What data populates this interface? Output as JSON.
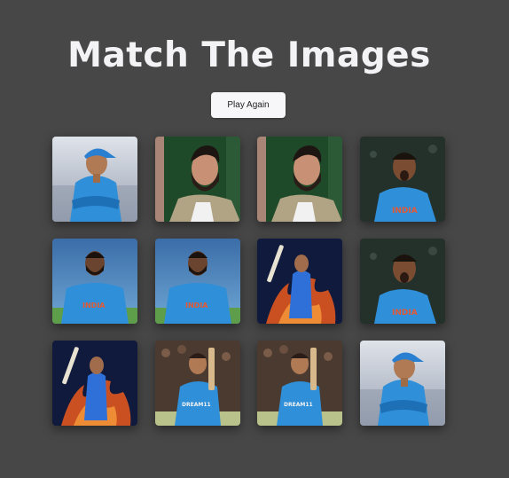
{
  "game": {
    "title": "Match The Images",
    "play_again_label": "Play Again"
  },
  "cards": [
    {
      "image": "player-cap-arms-crossed"
    },
    {
      "image": "player-beard-green-backdrop"
    },
    {
      "image": "player-beard-green-backdrop"
    },
    {
      "image": "player-celebrating-shout"
    },
    {
      "image": "player-portrait-stadium"
    },
    {
      "image": "player-portrait-stadium"
    },
    {
      "image": "player-bat-raised-fire"
    },
    {
      "image": "player-celebrating-shout"
    },
    {
      "image": "player-bat-raised-fire"
    },
    {
      "image": "player-holding-bat-crowd"
    },
    {
      "image": "player-holding-bat-crowd"
    },
    {
      "image": "player-cap-arms-crossed"
    }
  ],
  "colors": {
    "background": "#474747",
    "jersey": "#2f8fd8",
    "button": "#f7f7f9",
    "title": "#f3f3f6"
  }
}
